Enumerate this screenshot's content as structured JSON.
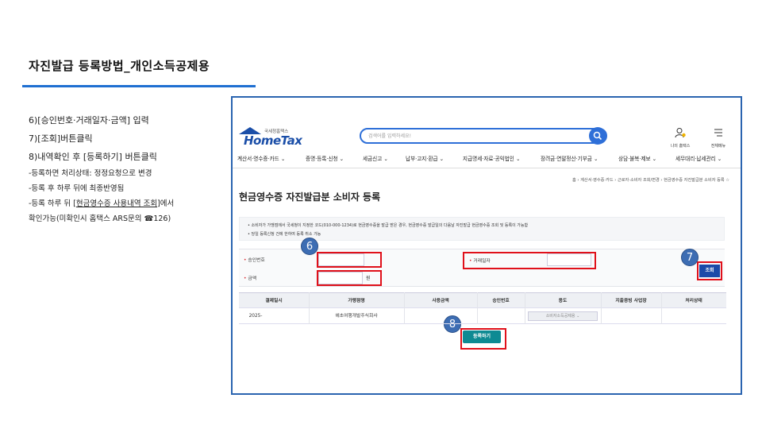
{
  "slide": {
    "title": "자진발급 등록방법_개인소득공제용",
    "accent_color": "#1f6fd1"
  },
  "steps": {
    "step6": "6)[승인번호·거래일자·금액]  입력",
    "step7": "7)[조회]버튼클릭",
    "step8": "8)내역확인 후 [등록하기] 버튼클릭",
    "note1": "-등록하면 처리상태: 정정요청으로 변경",
    "note2": "-등록 후 하루 뒤에 최종반영됨",
    "note3_a": "-등록 하루 뒤 [",
    "note3_link": "현금영수증 사용내역 조회",
    "note3_b": "]에서",
    "note4": " 확인가능(미확인시 홈택스 ARS문의 ☎126)"
  },
  "hometax": {
    "logo_small": "국세청홈택스",
    "logo_big": "HomeTax",
    "search_placeholder": "검색어를 입력하세요!",
    "my_hometax": "나의 홈택스",
    "all_menu": "전체메뉴",
    "gnb": [
      "계산서·영수증·카드 ⌄",
      "증명·등록·신청 ⌄",
      "세금신고 ⌄",
      "납부·고지·환급 ⌄",
      "지급명세·자료·공익법인 ⌄",
      "장려금·연말정산·기부금 ⌄",
      "상담·불복·제보 ⌄",
      "세무대리·납세관리 ⌄"
    ],
    "breadcrumb": "홈 › 계산서·영수증·카드 › 근로자·소비자 조회/변경 › 현금영수증 자진발급분 소비자 등록 ☆",
    "page_title": "현금영수증 자진발급분 소비자 등록",
    "notice1": "• 소비자가 가맹점에서 국세청이 지정한 코드(010-000-1234)로 현금영수증을 발급 받은 경우, 현금영수증 발급일의 다음날 자진발급 현금영수증 조회 및 등록이 가능함",
    "notice2": "• 당일 등록신청 건에 한하여 등록 취소 가능",
    "form": {
      "approval_label": "승인번호",
      "date_label": "거래일자",
      "amount_label": "금액",
      "won": "원",
      "search_button": "조회"
    },
    "grid": {
      "headers": [
        "결제일시",
        "가맹점명",
        "사용금액",
        "승인번호",
        "용도",
        "지출증빙 사업장",
        "처리상태"
      ],
      "row": [
        "2025-",
        "헤초여행개발주식회사",
        "",
        "",
        "소비자소득공제용",
        "",
        ""
      ]
    },
    "register_button": "등록하기"
  },
  "markers": {
    "m6": "6",
    "m7": "7",
    "m8": "8"
  }
}
